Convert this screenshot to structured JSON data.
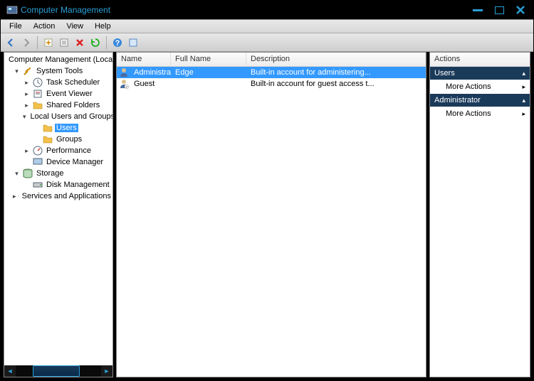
{
  "window": {
    "title": "Computer Management"
  },
  "menu": {
    "file": "File",
    "action": "Action",
    "view": "View",
    "help": "Help"
  },
  "tree": {
    "root": "Computer Management (Local)",
    "system_tools": "System Tools",
    "task_scheduler": "Task Scheduler",
    "event_viewer": "Event Viewer",
    "shared_folders": "Shared Folders",
    "local_users": "Local Users and Groups",
    "users": "Users",
    "groups": "Groups",
    "performance": "Performance",
    "device_manager": "Device Manager",
    "storage": "Storage",
    "disk_management": "Disk Management",
    "services_apps": "Services and Applications"
  },
  "list": {
    "columns": {
      "name": "Name",
      "full_name": "Full Name",
      "description": "Description"
    },
    "rows": [
      {
        "name": "Administrator",
        "full_name": "Edge",
        "description": "Built-in account for administering..."
      },
      {
        "name": "Guest",
        "full_name": "",
        "description": "Built-in account for guest access t..."
      }
    ]
  },
  "actions": {
    "title": "Actions",
    "sections": [
      {
        "heading": "Users",
        "item": "More Actions"
      },
      {
        "heading": "Administrator",
        "item": "More Actions"
      }
    ]
  }
}
